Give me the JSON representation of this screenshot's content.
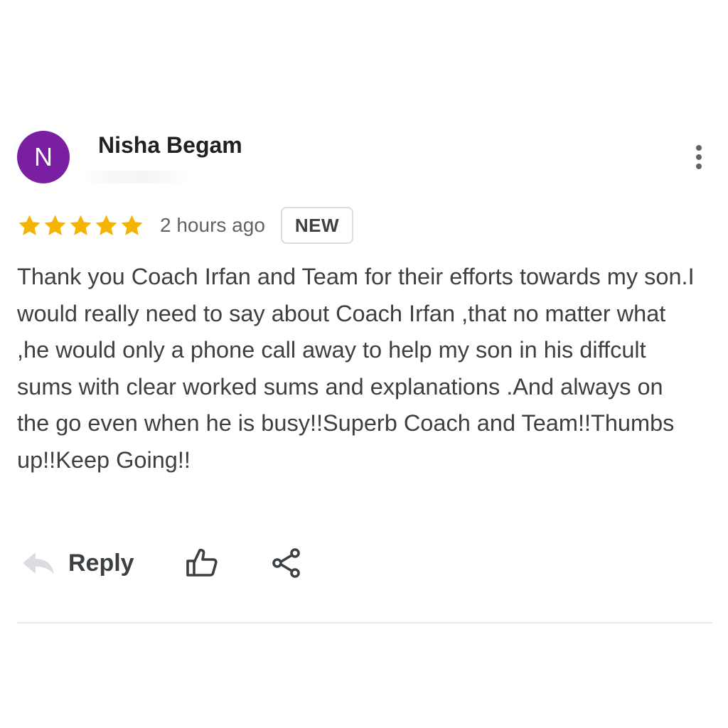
{
  "reviewer": {
    "initial": "N",
    "name": "Nisha Begam",
    "avatar_color": "#7b1fa2"
  },
  "more_menu_icon": "three-dots-vertical",
  "rating": {
    "stars": 5,
    "max_stars": 5,
    "star_color": "#f4b400"
  },
  "time_ago": "2 hours ago",
  "badge": "NEW",
  "review_text": "Thank you Coach Irfan and Team for their efforts towards my son.I would really need to say about Coach Irfan ,that no matter what ,he would only a phone call away to help my son in his diffcult sums with clear worked sums and explanations .And always on the go even when he is busy!!Superb Coach and Team!!Thumbs up!!Keep Going!!",
  "actions": {
    "reply_label": "Reply",
    "reply_icon": "reply-arrow",
    "like_icon": "thumbs-up-outline",
    "share_icon": "share-nodes"
  }
}
